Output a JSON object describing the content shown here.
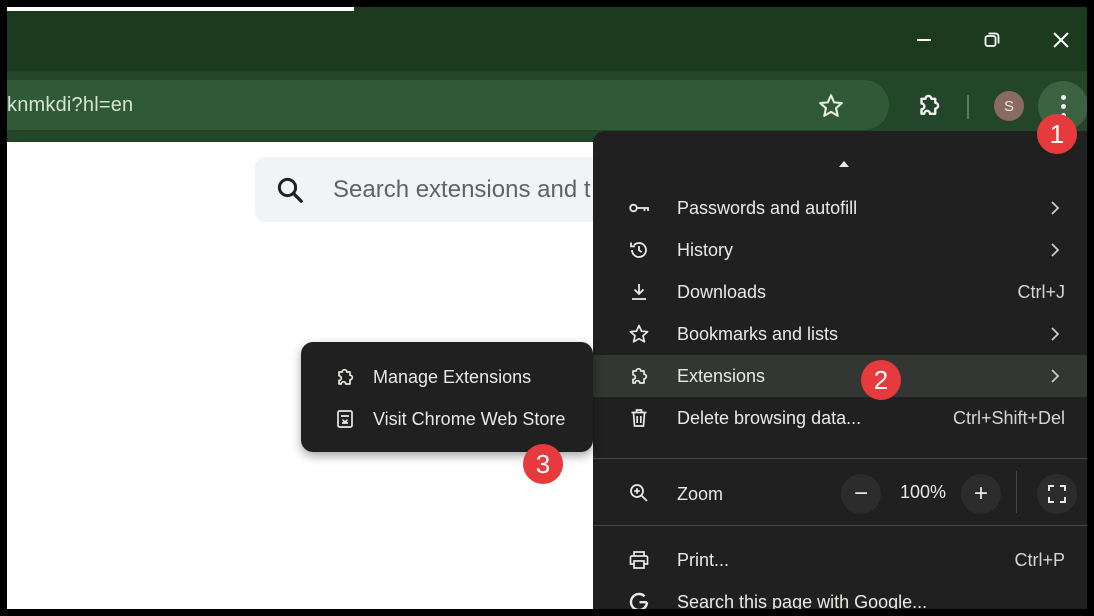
{
  "window": {
    "minimize_icon": "minimize-icon",
    "restore_icon": "restore-icon",
    "close_icon": "close-icon"
  },
  "toolbar": {
    "url": "knmkdi?hl=en",
    "avatar_initial": "S"
  },
  "page": {
    "search_placeholder": "Search extensions and t"
  },
  "menu": {
    "items": [
      {
        "label": "Passwords and autofill",
        "icon": "key-icon",
        "shortcut": "",
        "submenu": true
      },
      {
        "label": "History",
        "icon": "history-icon",
        "shortcut": "",
        "submenu": true
      },
      {
        "label": "Downloads",
        "icon": "download-icon",
        "shortcut": "Ctrl+J",
        "submenu": false
      },
      {
        "label": "Bookmarks and lists",
        "icon": "star-icon",
        "shortcut": "",
        "submenu": true
      },
      {
        "label": "Extensions",
        "icon": "puzzle-icon",
        "shortcut": "",
        "submenu": true
      },
      {
        "label": "Delete browsing data...",
        "icon": "trash-icon",
        "shortcut": "Ctrl+Shift+Del",
        "submenu": false
      }
    ],
    "zoom": {
      "label": "Zoom",
      "minus": "−",
      "value": "100%",
      "plus": "+"
    },
    "print": {
      "label": "Print...",
      "shortcut": "Ctrl+P"
    },
    "search_google": {
      "label": "Search this page with Google..."
    }
  },
  "submenu": {
    "items": [
      {
        "label": "Manage Extensions",
        "icon": "puzzle-icon"
      },
      {
        "label": "Visit Chrome Web Store",
        "icon": "web-store-icon"
      }
    ]
  },
  "badges": [
    "1",
    "2",
    "3"
  ],
  "colors": {
    "titlebar": "#1b3a1e",
    "toolbar": "#23452a",
    "menu_bg": "#1f201f",
    "badge": "#e63a3d"
  }
}
